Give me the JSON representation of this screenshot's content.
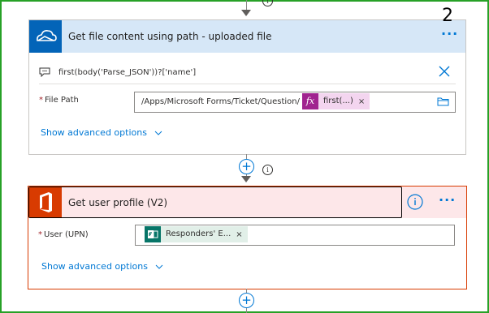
{
  "step_number": "2",
  "card1": {
    "title": "Get file content using path - uploaded file",
    "icon": "onedrive-cloud-icon",
    "more_label": "···",
    "expression": "first(body('Parse_JSON'))?['name']",
    "file_path": {
      "label": "File Path",
      "required_mark": "*",
      "value": "/Apps/Microsoft Forms/Ticket/Question/",
      "token_label": "first(...)",
      "token_icon_label": "fx",
      "token_remove": "×",
      "token_color": "#f3d5ef"
    },
    "advanced_label": "Show advanced options"
  },
  "card2": {
    "title": "Get user profile (V2)",
    "icon": "office-icon",
    "more_label": "···",
    "user_field": {
      "label": "User (UPN)",
      "required_mark": "*",
      "token_label": "Responders' E...",
      "token_remove": "×",
      "token_color": "#e1efe8"
    },
    "advanced_label": "Show advanced options"
  },
  "colors": {
    "accent": "#0078d4",
    "onedrive": "#0364b8",
    "office": "#d83b01",
    "forms": "#077568",
    "frame": "#27a127"
  }
}
